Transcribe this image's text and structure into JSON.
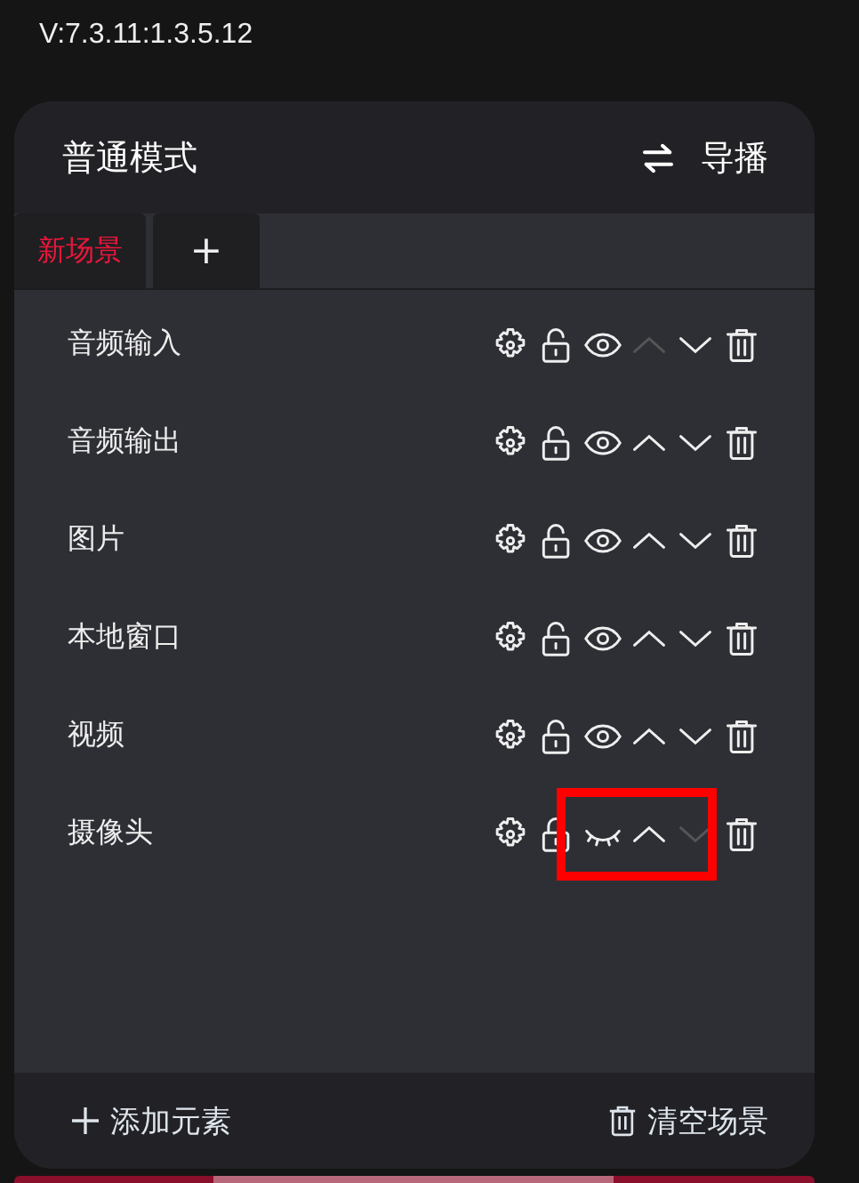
{
  "version": "V:7.3.11:1.3.5.12",
  "header": {
    "title": "普通模式",
    "switch_label": "导播"
  },
  "tabs": [
    {
      "label": "新场景",
      "selected": true
    },
    {
      "label": "+",
      "selected": false
    }
  ],
  "rows": [
    {
      "name": "音频输入",
      "visible": true,
      "up_disabled": true,
      "down_disabled": false,
      "highlighted": false
    },
    {
      "name": "音频输出",
      "visible": true,
      "up_disabled": false,
      "down_disabled": false,
      "highlighted": false
    },
    {
      "name": "图片",
      "visible": true,
      "up_disabled": false,
      "down_disabled": false,
      "highlighted": false
    },
    {
      "name": "本地窗口",
      "visible": true,
      "up_disabled": false,
      "down_disabled": false,
      "highlighted": false
    },
    {
      "name": "视频",
      "visible": true,
      "up_disabled": false,
      "down_disabled": false,
      "highlighted": false
    },
    {
      "name": "摄像头",
      "visible": false,
      "up_disabled": false,
      "down_disabled": true,
      "highlighted": true
    }
  ],
  "footer": {
    "add_label": "添加元素",
    "clear_label": "清空场景"
  }
}
